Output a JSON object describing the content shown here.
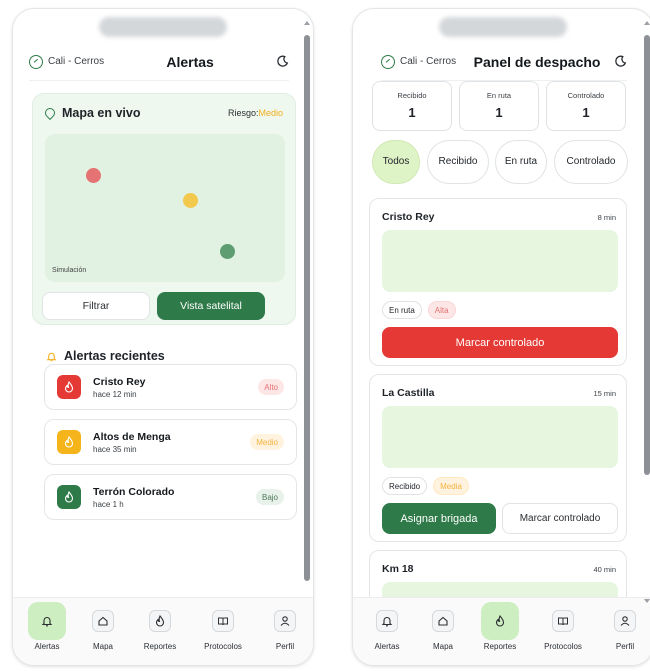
{
  "left": {
    "location": "Cali - Cerros",
    "title": "Alertas",
    "map": {
      "title": "Mapa en vivo",
      "risk_label": "Riesgo:",
      "risk_value": "Medio",
      "simulation_label": "Simulación",
      "filter_label": "Filtrar",
      "satellite_label": "Vista satelital"
    },
    "recent_title": "Alertas recientes",
    "alerts": [
      {
        "name": "Cristo Rey",
        "time": "hace 12 min",
        "severity": "Alto"
      },
      {
        "name": "Altos de Menga",
        "time": "hace 35 min",
        "severity": "Medio"
      },
      {
        "name": "Terrón Colorado",
        "time": "hace 1 h",
        "severity": "Bajo"
      }
    ],
    "nav": [
      "Alertas",
      "Mapa",
      "Reportes",
      "Protocolos",
      "Perfil"
    ]
  },
  "right": {
    "location": "Cali - Cerros",
    "title": "Panel de despacho",
    "stats": [
      {
        "label": "Recibido",
        "value": "1"
      },
      {
        "label": "En ruta",
        "value": "1"
      },
      {
        "label": "Controlado",
        "value": "1"
      }
    ],
    "filters": [
      "Todos",
      "Recibido",
      "En ruta",
      "Controlado"
    ],
    "orders": [
      {
        "name": "Cristo Rey",
        "eta": "8 min",
        "status": "En ruta",
        "severity": "Alta",
        "action": "Marcar controlado"
      },
      {
        "name": "La Castilla",
        "eta": "15 min",
        "status": "Recibido",
        "severity": "Media",
        "action_primary": "Asignar brigada",
        "action_secondary": "Marcar controlado"
      },
      {
        "name": "Km 18",
        "eta": "40 min"
      }
    ],
    "nav": [
      "Alertas",
      "Mapa",
      "Reportes",
      "Protocolos",
      "Perfil"
    ]
  },
  "colors": {
    "brand_green": "#2e7a48",
    "alert_red": "#e53935",
    "medium_yellow": "#f4b23f",
    "map_bg": "#e1f2e2",
    "active_nav": "#cdeec1"
  },
  "icons": {
    "location": "location-check-icon",
    "theme": "moon-icon",
    "fire": "flame-icon",
    "bell": "bell-icon",
    "home": "home-icon",
    "book": "book-icon",
    "user": "user-icon"
  }
}
